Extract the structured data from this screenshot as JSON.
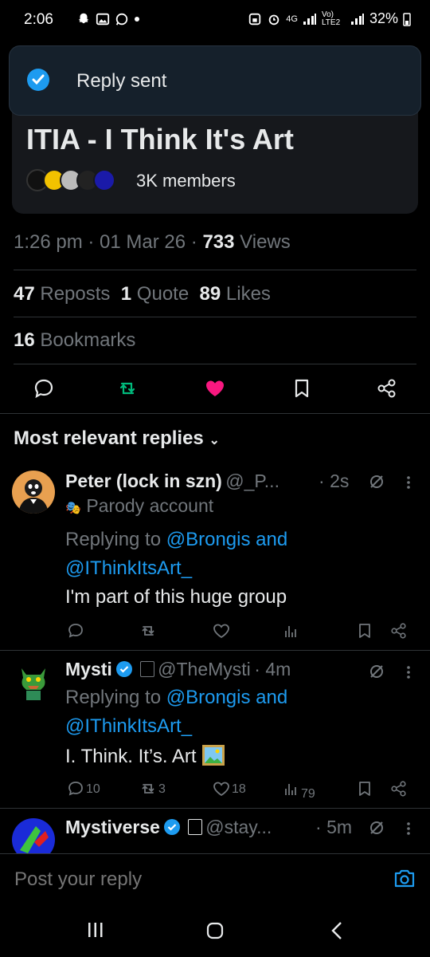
{
  "status": {
    "time": "2:06",
    "network": "4G",
    "carrier": "Vo) LTE2",
    "battery": "32%"
  },
  "toast": {
    "label": "Reply sent"
  },
  "community": {
    "title": "ITIA - I Think It's Art",
    "members": "3K members"
  },
  "meta": {
    "time": "1:26 pm",
    "date": "01 Mar 26",
    "views_count": "733",
    "views_label": "Views",
    "reposts_count": "47",
    "reposts_label": "Reposts",
    "quotes_count": "1",
    "quotes_label": "Quote",
    "likes_count": "89",
    "likes_label": "Likes",
    "bookmarks_count": "16",
    "bookmarks_label": "Bookmarks"
  },
  "replies_header": {
    "label": "Most relevant replies"
  },
  "replies": [
    {
      "name": "Peter (lock in szn)",
      "handle": "@_P...",
      "time": "2s",
      "tag": "Parody account",
      "replying_prefix": "Replying to",
      "mention1": "@Brongis",
      "and": "and",
      "mention2": "@IThinkItsArt_",
      "text": "I'm part of this huge group",
      "counts": {
        "replies": "",
        "reposts": "",
        "likes": "",
        "views": ""
      }
    },
    {
      "name": "Mysti",
      "handle": "@TheMysti",
      "time": "4m",
      "replying_prefix": "Replying to",
      "mention1": "@Brongis",
      "and": "and",
      "mention2": "@IThinkItsArt_",
      "text": "I. Think. It’s. Art",
      "counts": {
        "replies": "10",
        "reposts": "3",
        "likes": "18",
        "views": "79"
      }
    },
    {
      "name": "Mystiverse",
      "handle": "@stay...",
      "time": "5m"
    }
  ],
  "compose": {
    "placeholder": "Post your reply"
  },
  "colors": {
    "accent": "#1d9bf0",
    "like": "#f91880",
    "repost": "#00ba7c",
    "muted": "#71767b"
  }
}
